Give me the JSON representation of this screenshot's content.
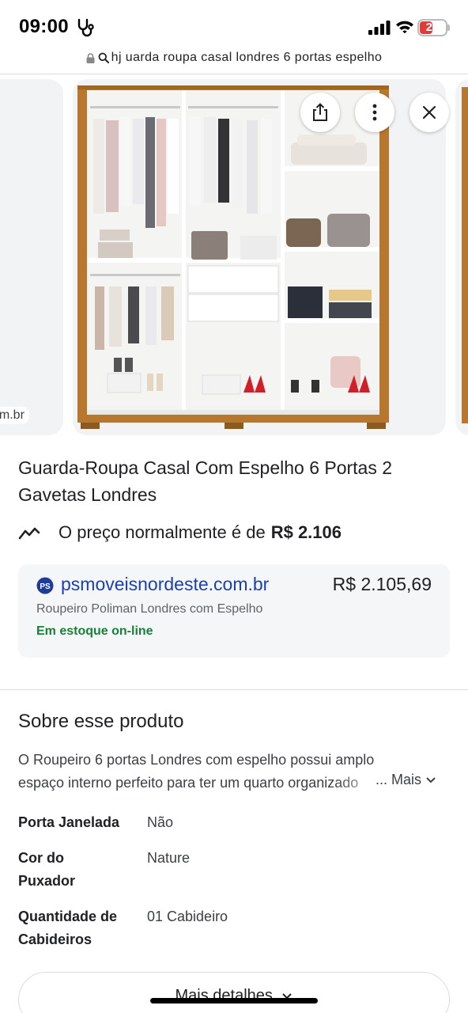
{
  "status_bar": {
    "time": "09:00",
    "battery_level": "20"
  },
  "url_bar": {
    "query": "hj uarda roupa casal londres 6 portas espelho"
  },
  "carousel": {
    "left_card_label": "com.br"
  },
  "product": {
    "title": "Guarda-Roupa Casal Com Espelho 6 Portas 2 Gavetas Londres",
    "price_note_prefix": "O preço normalmente é de",
    "price_note_value": "R$ 2.106"
  },
  "merchant": {
    "name": "psmoveisnordeste.com.br",
    "logo_text": "PS",
    "price": "R$ 2.105,69",
    "description": "Roupeiro Poliman Londres com Espelho",
    "stock": "Em estoque on-line"
  },
  "about": {
    "title": "Sobre esse produto",
    "description_line1": "O Roupeiro 6 portas Londres com espelho possui amplo",
    "description_line2": "espaço interno perfeito para ter um quarto organizado",
    "more_label": "... Mais"
  },
  "specs": [
    {
      "label": "Porta Janelada",
      "value": "Não"
    },
    {
      "label": "Cor do Puxador",
      "value": "Nature"
    },
    {
      "label": "Quantidade de Cabideiros",
      "value": "01 Cabideiro"
    }
  ],
  "details_button": {
    "label": "Mais detalhes"
  },
  "colors": {
    "link": "#1a3fb5",
    "in_stock": "#188038",
    "wardrobe_wood": "#b8772e",
    "battery": "#e53935"
  }
}
